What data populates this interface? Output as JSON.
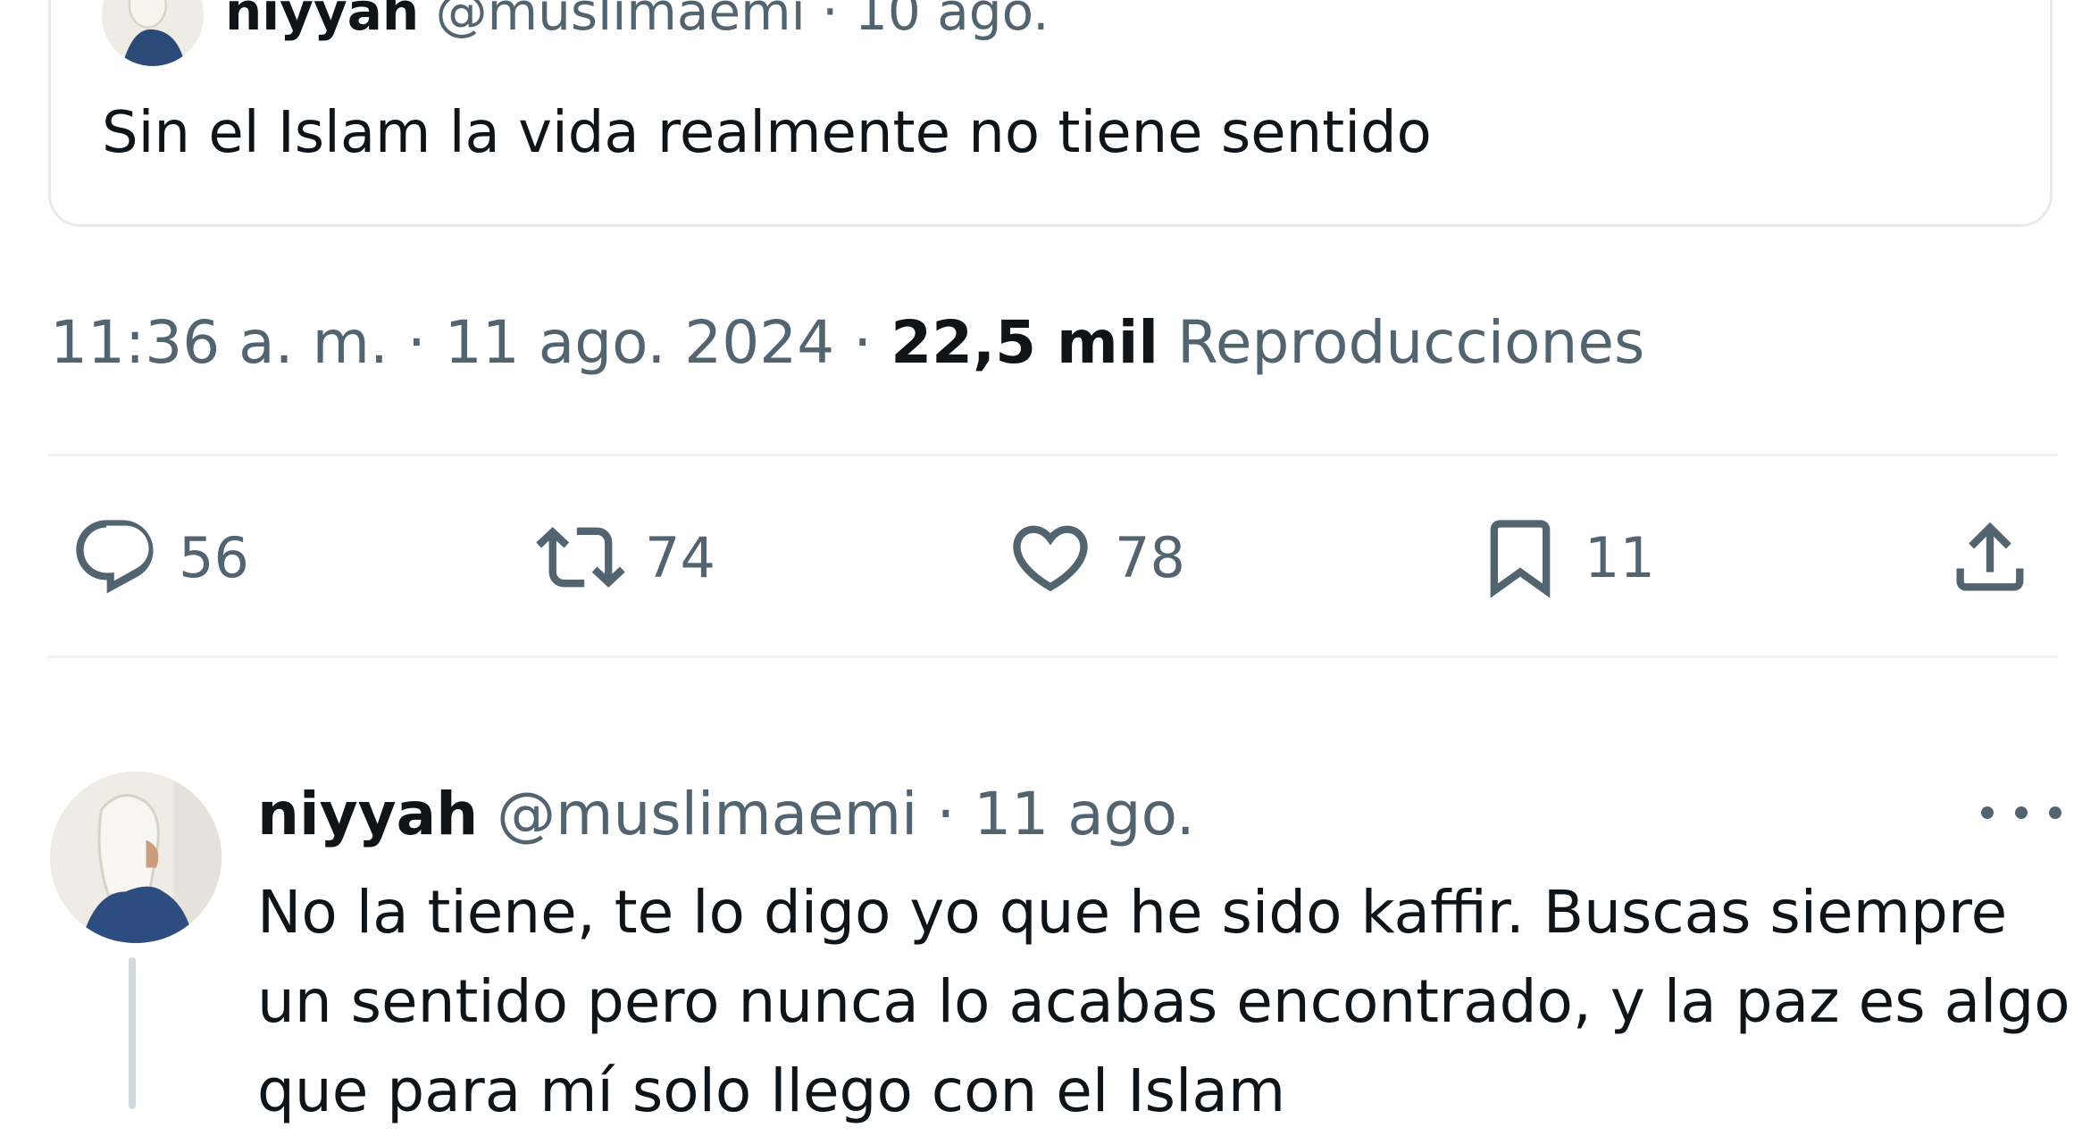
{
  "quoted_tweet": {
    "display_name": "niyyah",
    "handle": "@muslimaemi",
    "date": "· 10 ago.",
    "text": "Sin el Islam la vida realmente no tiene sentido"
  },
  "tweet_meta": {
    "time": "11:36 a. m.",
    "date": "· 11 ago. 2024 ·",
    "views_count": "22,5 mil",
    "views_label": "Reproducciones"
  },
  "actions": {
    "replies": "56",
    "reposts": "74",
    "likes": "78",
    "bookmarks": "11"
  },
  "reply": {
    "display_name": "niyyah",
    "handle": "@muslimaemi",
    "date": "· 11 ago.",
    "text": "No la tiene, te lo digo yo que he sido kaffir. Buscas siempre un sentido pero nunca lo acabas encontrado, y la paz es algo que para mí solo llego con el Islam"
  },
  "colors": {
    "text": "#0f1419",
    "muted": "#536471",
    "border": "#e7e9ea"
  },
  "icons": [
    "reply-icon",
    "repost-icon",
    "like-icon",
    "bookmark-icon",
    "share-icon",
    "more-icon"
  ]
}
